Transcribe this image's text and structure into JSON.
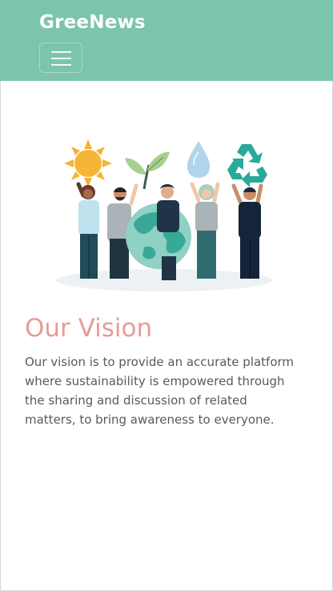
{
  "navbar": {
    "brand": "GreeNews",
    "menu_icon": "hamburger-menu-icon",
    "background": "#7cc4ad"
  },
  "vision": {
    "title": "Our Vision",
    "text": "Our vision is to provide an accurate platform where sustainability is empowered through the sharing and discussion of related matters, to bring awareness to everyone.",
    "title_color": "#e89b9b"
  },
  "illustration": {
    "icons": [
      "sun-icon",
      "leaf-sprout-icon",
      "water-drop-icon",
      "recycle-icon",
      "globe-icon"
    ]
  }
}
